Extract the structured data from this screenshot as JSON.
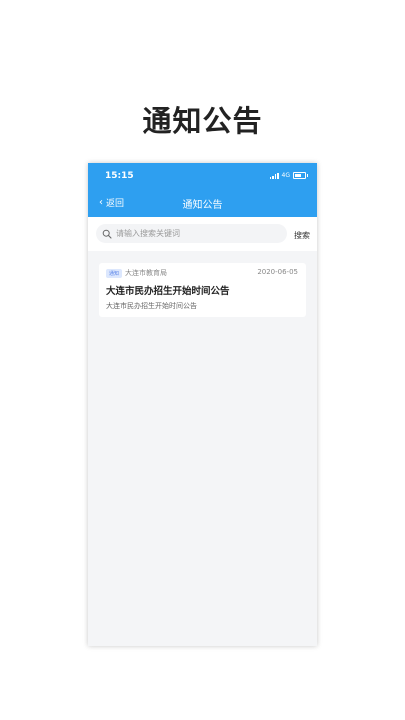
{
  "promo_title": "通知公告",
  "status_bar": {
    "time": "15:15",
    "network": "4G"
  },
  "nav": {
    "back_label": "返回",
    "title": "通知公告"
  },
  "search": {
    "placeholder": "请输入搜索关键词",
    "button_label": "搜索"
  },
  "notices": [
    {
      "tag": "通知",
      "source": "大连市教育局",
      "date": "2020-06-05",
      "title": "大连市民办招生开始时间公告",
      "summary": "大连市民办招生开始时间公告"
    }
  ],
  "colors": {
    "header": "#2e9ff0",
    "tag_bg": "#dce7fd",
    "tag_text": "#5c85e8",
    "page_bg": "#f4f5f7"
  }
}
